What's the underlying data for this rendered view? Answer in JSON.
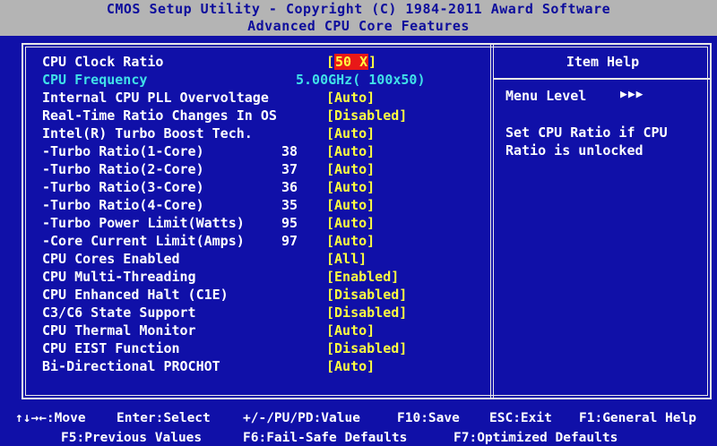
{
  "header": {
    "title_line1": "CMOS Setup Utility - Copyright (C) 1984-2011 Award Software",
    "title_line2": "Advanced CPU Core Features"
  },
  "settings": [
    {
      "label": "CPU Clock Ratio",
      "num": "",
      "value_prefix": "[",
      "value_highlight": "50 X",
      "value_suffix": "]",
      "type": "selected"
    },
    {
      "label": "CPU Frequency",
      "num": "",
      "value": "5.00GHz( 100x50)",
      "type": "info"
    },
    {
      "label": "Internal CPU PLL Overvoltage",
      "num": "",
      "value": "[Auto]",
      "type": "option"
    },
    {
      "label": "Real-Time Ratio Changes In OS",
      "num": "",
      "value": "[Disabled]",
      "type": "option"
    },
    {
      "label": "Intel(R) Turbo Boost Tech.",
      "num": "",
      "value": "[Auto]",
      "type": "option"
    },
    {
      "label": "-Turbo Ratio(1-Core)",
      "num": "38",
      "value": "[Auto]",
      "type": "option"
    },
    {
      "label": "-Turbo Ratio(2-Core)",
      "num": "37",
      "value": "[Auto]",
      "type": "option"
    },
    {
      "label": "-Turbo Ratio(3-Core)",
      "num": "36",
      "value": "[Auto]",
      "type": "option"
    },
    {
      "label": "-Turbo Ratio(4-Core)",
      "num": "35",
      "value": "[Auto]",
      "type": "option"
    },
    {
      "label": "-Turbo Power Limit(Watts)",
      "num": "95",
      "value": "[Auto]",
      "type": "option"
    },
    {
      "label": "-Core Current Limit(Amps)",
      "num": "97",
      "value": "[Auto]",
      "type": "option"
    },
    {
      "label": "CPU Cores Enabled",
      "num": "",
      "value": "[All]",
      "type": "option"
    },
    {
      "label": "CPU Multi-Threading",
      "num": "",
      "value": "[Enabled]",
      "type": "option"
    },
    {
      "label": "CPU Enhanced Halt (C1E)",
      "num": "",
      "value": "[Disabled]",
      "type": "option"
    },
    {
      "label": "C3/C6 State Support",
      "num": "",
      "value": "[Disabled]",
      "type": "option"
    },
    {
      "label": "CPU Thermal Monitor",
      "num": "",
      "value": "[Auto]",
      "type": "option"
    },
    {
      "label": "CPU EIST Function",
      "num": "",
      "value": "[Disabled]",
      "type": "option"
    },
    {
      "label": "Bi-Directional PROCHOT",
      "num": "",
      "value": "[Auto]",
      "type": "option"
    }
  ],
  "help": {
    "title": "Item Help",
    "menu_level_label": "Menu Level",
    "menu_level_arrows": "▶▶▶",
    "text_line1": "Set CPU Ratio if CPU",
    "text_line2": "Ratio is unlocked"
  },
  "footer": {
    "move": "↑↓→←:Move",
    "select": "Enter:Select",
    "value": "+/-/PU/PD:Value",
    "save": "F10:Save",
    "exit": "ESC:Exit",
    "general_help": "F1:General Help",
    "previous": "F5:Previous Values",
    "failsafe": "F6:Fail-Safe Defaults",
    "optimized": "F7:Optimized Defaults"
  },
  "colors": {
    "background": "#1010a8",
    "title_bar": "#b4b4b4",
    "value_text": "#ffff40",
    "info_text": "#40e0e8",
    "highlight": "#e81818"
  }
}
